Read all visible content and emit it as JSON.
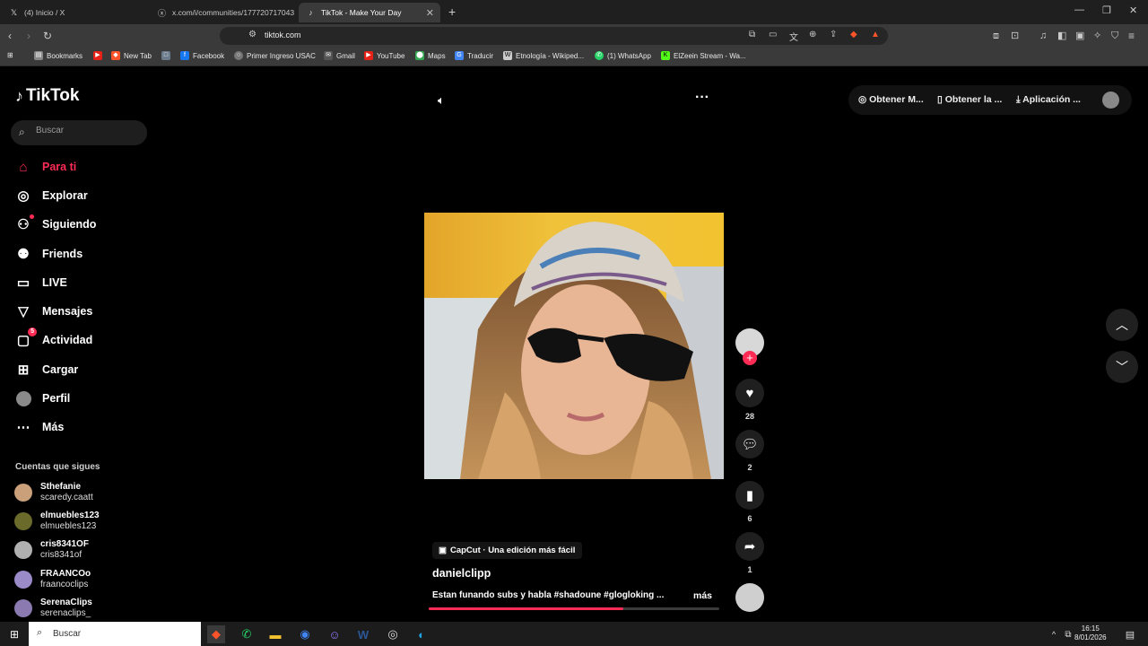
{
  "browser": {
    "tabs": [
      {
        "label": "(4) Inicio / X",
        "active": false
      },
      {
        "label": "x.com/i/communities/177720717043",
        "active": false
      },
      {
        "label": "TikTok - Make Your Day",
        "active": true
      }
    ],
    "url": "tiktok.com",
    "bookmarks": [
      {
        "label": "Bookmarks",
        "color": "#888888"
      },
      {
        "label": "",
        "color": "#e62117"
      },
      {
        "label": "New Tab",
        "color": "#fb542b"
      },
      {
        "label": "",
        "color": "#6b7b8c"
      },
      {
        "label": "Facebook",
        "color": "#1877f2"
      },
      {
        "label": "Primer Ingreso USAC",
        "color": "#777777"
      },
      {
        "label": "Gmail",
        "color": "#555555"
      },
      {
        "label": "YouTube",
        "color": "#e62117"
      },
      {
        "label": "Maps",
        "color": "#34a853"
      },
      {
        "label": "Traducir",
        "color": "#4285f4"
      },
      {
        "label": "Etnología - Wikiped...",
        "color": "#cccccc"
      },
      {
        "label": "(1) WhatsApp",
        "color": "#25d366"
      },
      {
        "label": "ElZeein Stream - Wa...",
        "color": "#53fc18"
      }
    ]
  },
  "tiktok": {
    "logo": "TikTok",
    "search_placeholder": "Buscar",
    "nav": [
      {
        "label": "Para ti",
        "icon": "home-icon",
        "active": true
      },
      {
        "label": "Explorar",
        "icon": "compass-icon"
      },
      {
        "label": "Siguiendo",
        "icon": "following-icon",
        "dot": true
      },
      {
        "label": "Friends",
        "icon": "friends-icon"
      },
      {
        "label": "LIVE",
        "icon": "live-icon"
      },
      {
        "label": "Mensajes",
        "icon": "messages-icon"
      },
      {
        "label": "Actividad",
        "icon": "activity-icon",
        "badge": "5"
      },
      {
        "label": "Cargar",
        "icon": "upload-icon"
      },
      {
        "label": "Perfil",
        "icon": "profile-icon"
      },
      {
        "label": "Más",
        "icon": "more-icon"
      }
    ],
    "following_title": "Cuentas que sigues",
    "following": [
      {
        "name": "Sthefanie",
        "username": "scaredy.caatt",
        "color": "#c9a07a"
      },
      {
        "name": "elmuebles123",
        "username": "elmuebles123",
        "color": "#6a6a2a"
      },
      {
        "name": "cris8341OF",
        "username": "cris8341of",
        "color": "#b0b0b0"
      },
      {
        "name": "FRAANCOo",
        "username": "fraancoclips",
        "color": "#9a8ac8"
      },
      {
        "name": "SerenaClips",
        "username": "serenaclips_",
        "color": "#8a7ab0"
      }
    ],
    "top_actions": [
      "Obtener M...",
      "Obtener la ...",
      "Aplicación ..."
    ],
    "video": {
      "badge": "CapCut · Una edición más fácil",
      "creator": "danielclipp",
      "description": "Estan funando subs y habla #shadoune #glogloking ...",
      "more_label": "más",
      "progress": 0.67
    },
    "actions": {
      "likes": "28",
      "comments": "2",
      "saves": "6",
      "shares": "1"
    }
  },
  "taskbar": {
    "search_placeholder": "Buscar",
    "time": "16:15",
    "date": "8/01/2026"
  }
}
